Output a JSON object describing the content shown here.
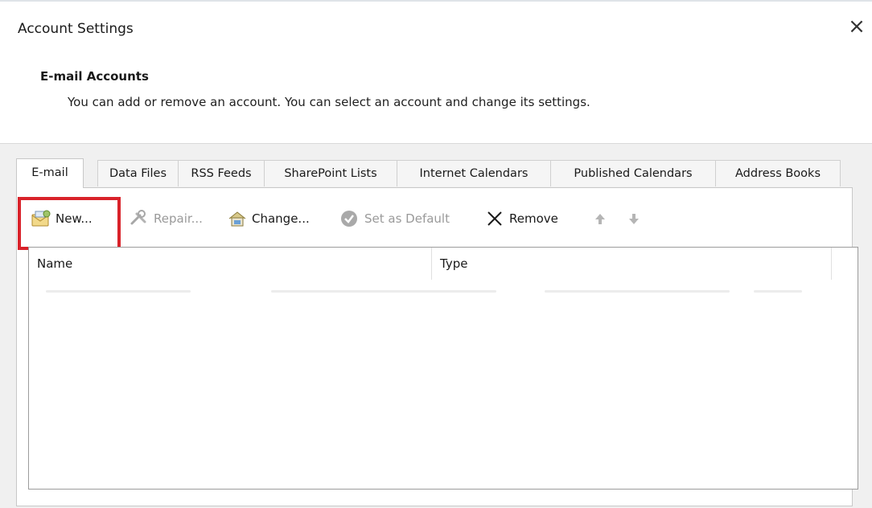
{
  "window": {
    "title": "Account Settings",
    "close_glyph": "×"
  },
  "header": {
    "section_title": "E-mail Accounts",
    "description": "You can add or remove an account. You can select an account and change its settings."
  },
  "tabs": [
    {
      "label": "E-mail",
      "active": true
    },
    {
      "label": "Data Files",
      "active": false
    },
    {
      "label": "RSS Feeds",
      "active": false
    },
    {
      "label": "SharePoint Lists",
      "active": false
    },
    {
      "label": "Internet Calendars",
      "active": false
    },
    {
      "label": "Published Calendars",
      "active": false
    },
    {
      "label": "Address Books",
      "active": false
    }
  ],
  "toolbar": {
    "new_label": "New...",
    "repair_label": "Repair...",
    "change_label": "Change...",
    "set_default_label": "Set as Default",
    "remove_label": "Remove",
    "highlight_color": "#d9222a"
  },
  "accounts_list": {
    "columns": [
      "Name",
      "Type"
    ]
  }
}
